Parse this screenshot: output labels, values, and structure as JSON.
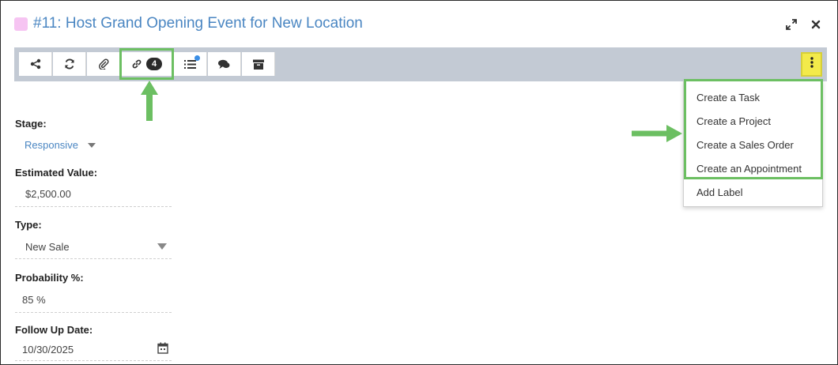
{
  "window": {
    "title": "#11: Host Grand Opening Event for New Location",
    "swatch_color": "#f6c4f2",
    "controls": [
      "expand-icon",
      "close-icon"
    ]
  },
  "toolbar": {
    "buttons": [
      {
        "icon": "share-icon"
      },
      {
        "icon": "refresh-icon"
      },
      {
        "icon": "paperclip-icon"
      },
      {
        "icon": "link-icon",
        "badge": "4"
      },
      {
        "icon": "list-icon",
        "notification": true
      },
      {
        "icon": "comments-icon"
      },
      {
        "icon": "archive-icon"
      }
    ],
    "more_icon": "vertical-ellipsis-icon",
    "more_color": "#f3ea4a"
  },
  "fields": {
    "stage": {
      "label": "Stage:",
      "value": "Responsive"
    },
    "estimated_value": {
      "label": "Estimated Value:",
      "value": "$2,500.00"
    },
    "type": {
      "label": "Type:",
      "value": "New Sale"
    },
    "probability": {
      "label": "Probability %:",
      "value": "85 %"
    },
    "follow_up_date": {
      "label": "Follow Up Date:",
      "value": "10/30/2025"
    }
  },
  "menu": {
    "items": [
      {
        "label": "Create a Task"
      },
      {
        "label": "Create a Project"
      },
      {
        "label": "Create a Sales Order"
      },
      {
        "label": "Create an Appointment"
      },
      {
        "label": "Add Label"
      }
    ]
  },
  "annotation": {
    "highlight_color": "#6cbf62"
  }
}
